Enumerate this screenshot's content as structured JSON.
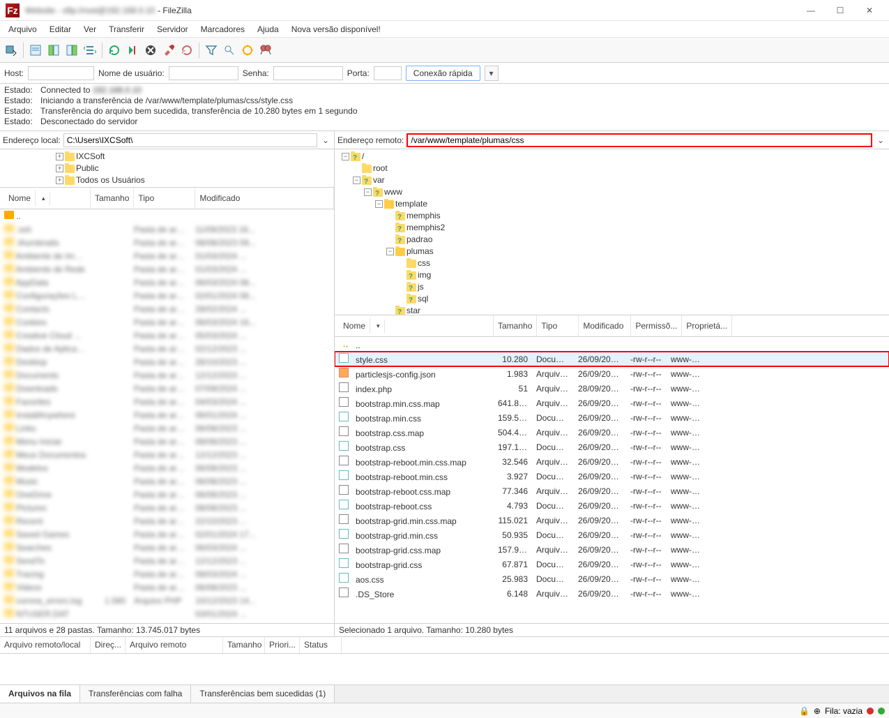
{
  "title": {
    "obscured": "Website - sftp://root@192.168.0.10",
    "app": " - FileZilla"
  },
  "menu": [
    "Arquivo",
    "Editar",
    "Ver",
    "Transferir",
    "Servidor",
    "Marcadores",
    "Ajuda"
  ],
  "menu_update": "Nova versão disponível!",
  "quickconnect": {
    "host_label": "Host:",
    "user_label": "Nome de usuário:",
    "pass_label": "Senha:",
    "port_label": "Porta:",
    "button": "Conexão rápida"
  },
  "log": [
    {
      "label": "Estado:",
      "msg_prefix": "Connected to ",
      "msg_blur": "192.168.0.10"
    },
    {
      "label": "Estado:",
      "msg": "Iniciando a transferência de /var/www/template/plumas/css/style.css"
    },
    {
      "label": "Estado:",
      "msg": "Transferência do arquivo bem sucedida, transferência de 10.280 bytes em 1 segundo"
    },
    {
      "label": "Estado:",
      "msg": "Desconectado do servidor"
    }
  ],
  "local": {
    "addr_label": "Endereço local:",
    "addr_value": "C:\\Users\\IXCSoft\\",
    "tree": [
      "IXCSoft",
      "Public",
      "Todos os Usuários"
    ],
    "cols": {
      "name": "Nome",
      "size": "Tamanho",
      "type": "Tipo",
      "mod": "Modificado"
    },
    "status": "11 arquivos e 28 pastas. Tamanho: 13.745.017 bytes",
    "rows": [
      {
        "name": "..",
        "size": "",
        "type": "",
        "mod": ""
      },
      {
        "name": ".ssh",
        "size": "",
        "type": "Pasta de arqu...",
        "mod": "11/09/2023 16..."
      },
      {
        "name": ".thumbnails",
        "size": "",
        "type": "Pasta de arqu...",
        "mod": "08/08/2023 09..."
      },
      {
        "name": "Ambiente de Impre...",
        "size": "",
        "type": "Pasta de arqu...",
        "mod": "01/03/2024 ..."
      },
      {
        "name": "Ambiente de Rede",
        "size": "",
        "type": "Pasta de arqu...",
        "mod": "01/03/2024 ..."
      },
      {
        "name": "AppData",
        "size": "",
        "type": "Pasta de arqu...",
        "mod": "06/03/2024 08..."
      },
      {
        "name": "Configurações Locais",
        "size": "",
        "type": "Pasta de arqu...",
        "mod": "02/01/2024 08..."
      },
      {
        "name": "Contacts",
        "size": "",
        "type": "Pasta de arqu...",
        "mod": "28/02/2024 ..."
      },
      {
        "name": "Cookies",
        "size": "",
        "type": "Pasta de arqu...",
        "mod": "06/03/2024 16..."
      },
      {
        "name": "Creative Cloud Files",
        "size": "",
        "type": "Pasta de arqu...",
        "mod": "05/03/2024 ..."
      },
      {
        "name": "Dados de Aplicativos",
        "size": "",
        "type": "Pasta de arqu...",
        "mod": "02/12/2023 ..."
      },
      {
        "name": "Desktop",
        "size": "",
        "type": "Pasta de arqu...",
        "mod": "28/10/2023 ..."
      },
      {
        "name": "Documents",
        "size": "",
        "type": "Pasta de arqu...",
        "mod": "12/12/2023 ..."
      },
      {
        "name": "Downloads",
        "size": "",
        "type": "Pasta de arqu...",
        "mod": "07/09/2024 ..."
      },
      {
        "name": "Favorites",
        "size": "",
        "type": "Pasta de arqu...",
        "mod": "04/03/2024 ..."
      },
      {
        "name": "InstallAnywhere",
        "size": "",
        "type": "Pasta de arqu...",
        "mod": "06/01/2024 ..."
      },
      {
        "name": "Links",
        "size": "",
        "type": "Pasta de arqu...",
        "mod": "06/08/2023 ..."
      },
      {
        "name": "Menu Iniciar",
        "size": "",
        "type": "Pasta de arqu...",
        "mod": "08/08/2023 ..."
      },
      {
        "name": "Meus Documentos",
        "size": "",
        "type": "Pasta de arqu...",
        "mod": "12/12/2023 ..."
      },
      {
        "name": "Modelos",
        "size": "",
        "type": "Pasta de arqu...",
        "mod": "06/08/2023 ..."
      },
      {
        "name": "Music",
        "size": "",
        "type": "Pasta de arqu...",
        "mod": "06/08/2023 ..."
      },
      {
        "name": "OneDrive",
        "size": "",
        "type": "Pasta de arqu...",
        "mod": "06/08/2023 ..."
      },
      {
        "name": "Pictures",
        "size": "",
        "type": "Pasta de arqu...",
        "mod": "08/08/2023 ..."
      },
      {
        "name": "Recent",
        "size": "",
        "type": "Pasta de arqu...",
        "mod": "22/10/2023 ..."
      },
      {
        "name": "Saved Games",
        "size": "",
        "type": "Pasta de arqu...",
        "mod": "02/01/2024 17..."
      },
      {
        "name": "Searches",
        "size": "",
        "type": "Pasta de arqu...",
        "mod": "06/03/2024 ..."
      },
      {
        "name": "SendTo",
        "size": "",
        "type": "Pasta de arqu...",
        "mod": "12/12/2023 ..."
      },
      {
        "name": "Tracing",
        "size": "",
        "type": "Pasta de arqu...",
        "mod": "08/03/2024 ..."
      },
      {
        "name": "Videos",
        "size": "",
        "type": "Pasta de arqu...",
        "mod": "06/08/2023 ..."
      },
      {
        "name": "corona_errors.log",
        "size": "1.580",
        "type": "Arquivo PHP",
        "mod": "10/12/2023 14..."
      },
      {
        "name": "NTUSER.DAT",
        "size": "",
        "type": "",
        "mod": "03/01/2024 ..."
      }
    ]
  },
  "remote": {
    "addr_label": "Endereço remoto:",
    "addr_value": "/var/www/template/plumas/css",
    "tree": [
      {
        "depth": 0,
        "exp": "-",
        "label": "/",
        "icon": "q"
      },
      {
        "depth": 1,
        "exp": "",
        "label": "root",
        "icon": "folder"
      },
      {
        "depth": 1,
        "exp": "-",
        "label": "var",
        "icon": "q"
      },
      {
        "depth": 2,
        "exp": "-",
        "label": "www",
        "icon": "q"
      },
      {
        "depth": 3,
        "exp": "-",
        "label": "template",
        "icon": "open"
      },
      {
        "depth": 4,
        "exp": "",
        "label": "memphis",
        "icon": "q"
      },
      {
        "depth": 4,
        "exp": "",
        "label": "memphis2",
        "icon": "q"
      },
      {
        "depth": 4,
        "exp": "",
        "label": "padrao",
        "icon": "q"
      },
      {
        "depth": 4,
        "exp": "-",
        "label": "plumas",
        "icon": "open"
      },
      {
        "depth": 5,
        "exp": "",
        "label": "css",
        "icon": "folder"
      },
      {
        "depth": 5,
        "exp": "",
        "label": "img",
        "icon": "q"
      },
      {
        "depth": 5,
        "exp": "",
        "label": "js",
        "icon": "q"
      },
      {
        "depth": 5,
        "exp": "",
        "label": "sql",
        "icon": "q"
      },
      {
        "depth": 4,
        "exp": "",
        "label": "star",
        "icon": "q"
      }
    ],
    "cols": {
      "name": "Nome",
      "size": "Tamanho",
      "type": "Tipo",
      "mod": "Modificado",
      "perm": "Permissõ...",
      "own": "Proprietá..."
    },
    "rows": [
      {
        "name": "..",
        "size": "",
        "type": "",
        "mod": "",
        "perm": "",
        "own": "",
        "icon": "up"
      },
      {
        "name": "style.css",
        "size": "10.280",
        "type": "Docume...",
        "mod": "26/09/2023...",
        "perm": "-rw-r--r--",
        "own": "www-dat...",
        "icon": "css",
        "hl": true
      },
      {
        "name": "particlesjs-config.json",
        "size": "1.983",
        "type": "Arquivo ...",
        "mod": "26/09/2023...",
        "perm": "-rw-r--r--",
        "own": "www-dat...",
        "icon": "json"
      },
      {
        "name": "index.php",
        "size": "51",
        "type": "Arquivo ...",
        "mod": "28/09/2023...",
        "perm": "-rw-r--r--",
        "own": "www-dat...",
        "icon": "file"
      },
      {
        "name": "bootstrap.min.css.map",
        "size": "641.867",
        "type": "Arquivo ...",
        "mod": "26/09/2023...",
        "perm": "-rw-r--r--",
        "own": "www-dat...",
        "icon": "file"
      },
      {
        "name": "bootstrap.min.css",
        "size": "159.515",
        "type": "Docume...",
        "mod": "26/09/2023...",
        "perm": "-rw-r--r--",
        "own": "www-dat...",
        "icon": "css"
      },
      {
        "name": "bootstrap.css.map",
        "size": "504.418",
        "type": "Arquivo ...",
        "mod": "26/09/2023...",
        "perm": "-rw-r--r--",
        "own": "www-dat...",
        "icon": "file"
      },
      {
        "name": "bootstrap.css",
        "size": "197.170",
        "type": "Docume...",
        "mod": "26/09/2023...",
        "perm": "-rw-r--r--",
        "own": "www-dat...",
        "icon": "css"
      },
      {
        "name": "bootstrap-reboot.min.css.map",
        "size": "32.546",
        "type": "Arquivo ...",
        "mod": "26/09/2023...",
        "perm": "-rw-r--r--",
        "own": "www-dat...",
        "icon": "file"
      },
      {
        "name": "bootstrap-reboot.min.css",
        "size": "3.927",
        "type": "Docume...",
        "mod": "26/09/2023...",
        "perm": "-rw-r--r--",
        "own": "www-dat...",
        "icon": "css"
      },
      {
        "name": "bootstrap-reboot.css.map",
        "size": "77.346",
        "type": "Arquivo ...",
        "mod": "26/09/2023...",
        "perm": "-rw-r--r--",
        "own": "www-dat...",
        "icon": "file"
      },
      {
        "name": "bootstrap-reboot.css",
        "size": "4.793",
        "type": "Docume...",
        "mod": "26/09/2023...",
        "perm": "-rw-r--r--",
        "own": "www-dat...",
        "icon": "css"
      },
      {
        "name": "bootstrap-grid.min.css.map",
        "size": "115.021",
        "type": "Arquivo ...",
        "mod": "26/09/2023...",
        "perm": "-rw-r--r--",
        "own": "www-dat...",
        "icon": "file"
      },
      {
        "name": "bootstrap-grid.min.css",
        "size": "50.935",
        "type": "Docume...",
        "mod": "26/09/2023...",
        "perm": "-rw-r--r--",
        "own": "www-dat...",
        "icon": "css"
      },
      {
        "name": "bootstrap-grid.css.map",
        "size": "157.964",
        "type": "Arquivo ...",
        "mod": "26/09/2023...",
        "perm": "-rw-r--r--",
        "own": "www-dat...",
        "icon": "file"
      },
      {
        "name": "bootstrap-grid.css",
        "size": "67.871",
        "type": "Docume...",
        "mod": "26/09/2023...",
        "perm": "-rw-r--r--",
        "own": "www-dat...",
        "icon": "css"
      },
      {
        "name": "aos.css",
        "size": "25.983",
        "type": "Docume...",
        "mod": "26/09/2023...",
        "perm": "-rw-r--r--",
        "own": "www-dat...",
        "icon": "css"
      },
      {
        "name": ".DS_Store",
        "size": "6.148",
        "type": "Arquivo ...",
        "mod": "26/09/2023...",
        "perm": "-rw-r--r--",
        "own": "www-dat...",
        "icon": "file"
      }
    ],
    "status": "Selecionado 1 arquivo. Tamanho: 10.280 bytes"
  },
  "queue": {
    "cols": [
      "Arquivo remoto/local",
      "Direç...",
      "Arquivo remoto",
      "Tamanho",
      "Priori...",
      "Status"
    ]
  },
  "tabs": [
    "Arquivos na fila",
    "Transferências com falha",
    "Transferências bem sucedidas (1)"
  ],
  "footer": {
    "queue": "Fila: vazia"
  }
}
